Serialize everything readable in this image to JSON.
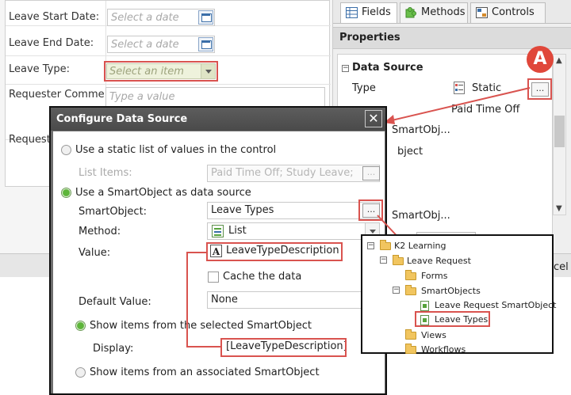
{
  "form": {
    "rows": [
      {
        "label": "Leave Start Date:",
        "placeholder": "Select a date"
      },
      {
        "label": "Leave End Date:",
        "placeholder": "Select a date"
      },
      {
        "label": "Leave Type:",
        "placeholder": "Select an item"
      },
      {
        "label": "Requester Commer",
        "placeholder": "Type a value"
      },
      {
        "label": "Request",
        "placeholder": ""
      }
    ]
  },
  "right_panel": {
    "tabs": [
      {
        "label": "Fields"
      },
      {
        "label": "Methods"
      },
      {
        "label": "Controls"
      }
    ],
    "properties_title": "Properties",
    "section_title": "Data Source",
    "type_label": "Type",
    "type_value": "Static",
    "ellipsis": "...",
    "item_paid_time_off": "Paid Time Off",
    "frag_smartobj": "SmartObj...",
    "frag_object": "bject",
    "frag_smartobj2": "SmartObj...",
    "frag_cel": "cel",
    "badge": "A"
  },
  "dialog": {
    "title": "Configure Data Source",
    "close": "✕",
    "static_option": "Use a static list of values in the control",
    "list_items_label": "List Items:",
    "list_items_value": "Paid Time Off; Study Leave;",
    "smartobject_option": "Use a SmartObject as data source",
    "smartobject_label": "SmartObject:",
    "smartobject_value": "Leave Types",
    "method_label": "Method:",
    "method_value": "List",
    "value_label": "Value:",
    "value_value": "LeaveTypeDescription",
    "cache_label": "Cache the data",
    "default_label": "Default Value:",
    "default_value": "None",
    "show_selected_option": "Show items from the selected SmartObject",
    "display_label": "Display:",
    "display_value": "[LeaveTypeDescription]",
    "show_associated_option": "Show items from an associated SmartObject",
    "ellipsis": "..."
  },
  "tree": {
    "items": [
      {
        "label": "K2 Learning"
      },
      {
        "label": "Leave Request"
      },
      {
        "label": "Forms"
      },
      {
        "label": "SmartObjects"
      },
      {
        "label": "Leave Request SmartObject"
      },
      {
        "label": "Leave Types"
      },
      {
        "label": "Views"
      },
      {
        "label": "Workflows"
      }
    ]
  },
  "colors": {
    "highlight": "#d9534f",
    "accent_green": "#5db53a"
  }
}
